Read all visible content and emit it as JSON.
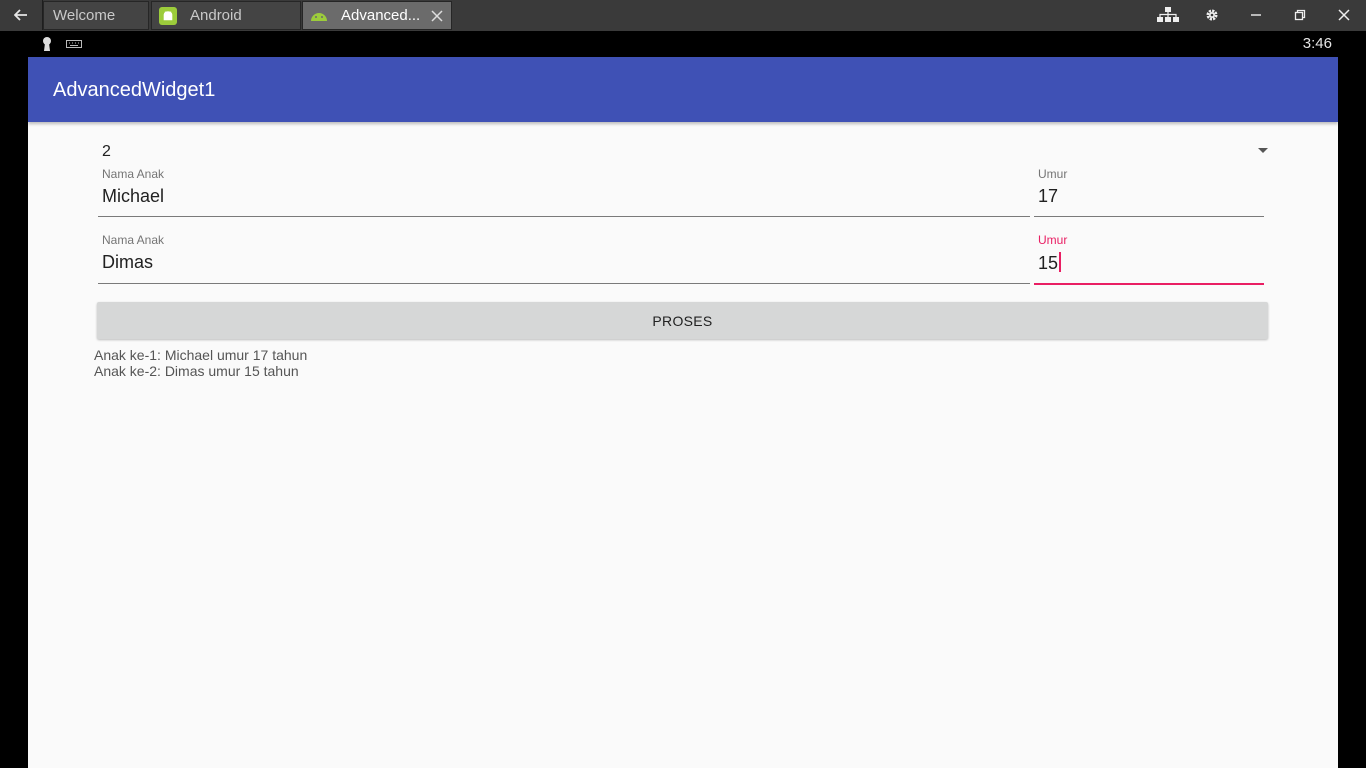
{
  "window": {
    "tabs": [
      {
        "label": "Welcome"
      },
      {
        "label": "Android"
      },
      {
        "label": "Advanced..."
      }
    ]
  },
  "statusbar": {
    "time": "3:46"
  },
  "app": {
    "title": "AdvancedWidget1",
    "spinner_value": "2",
    "children": [
      {
        "name_label": "Nama Anak",
        "name_value": "Michael",
        "age_label": "Umur",
        "age_value": "17"
      },
      {
        "name_label": "Nama Anak",
        "name_value": "Dimas",
        "age_label": "Umur",
        "age_value": "15"
      }
    ],
    "button_label": "PROSES",
    "results": [
      "Anak ke-1: Michael umur 17 tahun",
      "Anak ke-2: Dimas umur 15 tahun"
    ]
  },
  "colors": {
    "appbar": "#3f51b5",
    "accent": "#e91e63",
    "android_green": "#9ccc3b"
  }
}
